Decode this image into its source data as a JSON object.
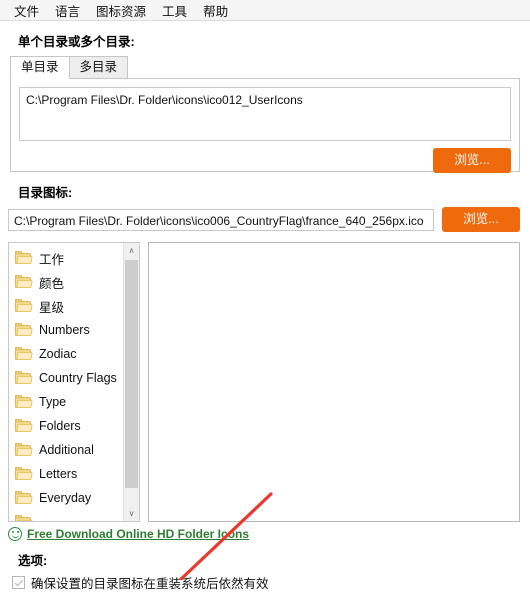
{
  "menubar": {
    "items": [
      {
        "label": "文件",
        "name": "menu-file"
      },
      {
        "label": "语言",
        "name": "menu-language"
      },
      {
        "label": "图标资源",
        "name": "menu-icon-resources"
      },
      {
        "label": "工具",
        "name": "menu-tools"
      },
      {
        "label": "帮助",
        "name": "menu-help"
      }
    ]
  },
  "directories_section": {
    "label": "单个目录或多个目录:",
    "tabs": [
      {
        "label": "单目录",
        "active": true
      },
      {
        "label": "多目录",
        "active": false
      }
    ],
    "path_value": "C:\\Program Files\\Dr. Folder\\icons\\ico012_UserIcons",
    "browse_label": "浏览..."
  },
  "icon_section": {
    "label": "目录图标:",
    "path_value": "C:\\Program Files\\Dr. Folder\\icons\\ico006_CountryFlag\\france_640_256px.ico",
    "browse_label": "浏览..."
  },
  "folder_list": {
    "items": [
      "工作",
      "颜色",
      "星级",
      "Numbers",
      "Zodiac",
      "Country Flags",
      "Type",
      "Folders",
      "Additional",
      "Letters",
      "Everyday"
    ],
    "scroll_up_glyph": "∧",
    "scroll_down_glyph": "∨"
  },
  "download": {
    "link_label": "Free Download Online HD Folder Icons",
    "icon": "smiley-icon",
    "color": "#2f7d32"
  },
  "options": {
    "label": "选项:",
    "checkbox_label": "确保设置的目录图标在重装系统后依然有效",
    "checked": true
  },
  "theme": {
    "accent": "#ee6a0c",
    "link": "#2f7d32",
    "border": "#c8c8c8",
    "annotation": "#e8382f"
  }
}
